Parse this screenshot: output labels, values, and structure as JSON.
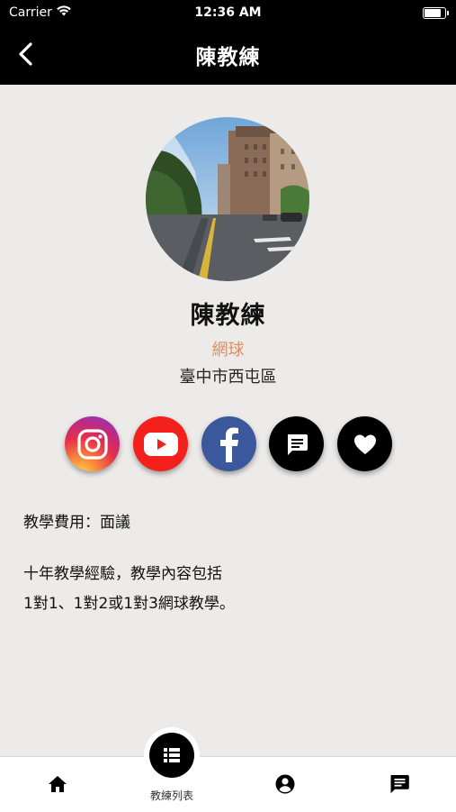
{
  "status_bar": {
    "carrier": "Carrier",
    "time": "12:36 AM",
    "battery_level": 0.9
  },
  "nav": {
    "title": "陳教練",
    "back_icon": "chevron-left-icon"
  },
  "profile": {
    "name": "陳教練",
    "sport": "網球",
    "location": "臺中市西屯區",
    "accent_color": "#e8895a"
  },
  "social_buttons": [
    {
      "icon": "instagram-icon",
      "color": "#e6304a"
    },
    {
      "icon": "youtube-icon",
      "color": "#f4201c"
    },
    {
      "icon": "facebook-icon",
      "color": "#3a589b"
    },
    {
      "icon": "message-icon",
      "color": "#000000"
    },
    {
      "icon": "heart-icon",
      "color": "#000000"
    }
  ],
  "details": {
    "fee": "教學費用：面議",
    "description_lines": [
      "十年教學經驗，教學內容包括",
      "1對1、1對2或1對3網球教學。"
    ]
  },
  "tabbar": {
    "items": [
      {
        "icon": "home-icon"
      },
      {
        "icon": "list-icon",
        "label": "教練列表"
      },
      {
        "icon": "account-icon"
      },
      {
        "icon": "chat-icon"
      }
    ]
  }
}
